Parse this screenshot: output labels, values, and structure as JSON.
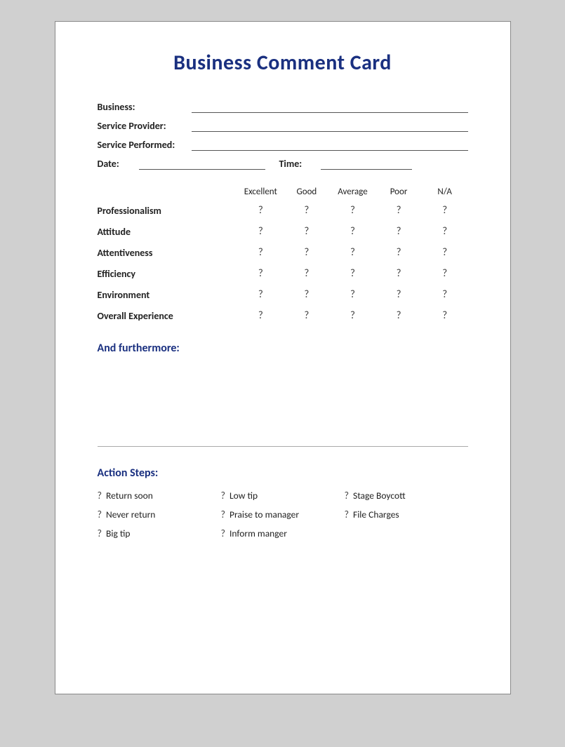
{
  "card": {
    "title": "Business Comment Card",
    "fields": {
      "business_label": "Business:",
      "service_provider_label": "Service Provider:",
      "service_performed_label": "Service Performed:",
      "date_label": "Date:",
      "time_label": "Time:"
    },
    "ratings": {
      "headers": [
        "Excellent",
        "Good",
        "Average",
        "Poor",
        "N/A"
      ],
      "rows": [
        {
          "label": "Professionalism"
        },
        {
          "label": "Attitude"
        },
        {
          "label": "Attentiveness"
        },
        {
          "label": "Efficiency"
        },
        {
          "label": "Environment"
        },
        {
          "label": "Overall Experience"
        }
      ],
      "symbol": "?"
    },
    "furthermore": {
      "title": "And furthermore:"
    },
    "action_steps": {
      "title": "Action Steps:",
      "items": [
        {
          "symbol": "?",
          "text": "Return soon"
        },
        {
          "symbol": "?",
          "text": "Never return"
        },
        {
          "symbol": "?",
          "text": "Big tip"
        },
        {
          "symbol": "?",
          "text": "Low tip"
        },
        {
          "symbol": "?",
          "text": "Praise to manager"
        },
        {
          "symbol": "?",
          "text": "Inform manger"
        },
        {
          "symbol": "?",
          "text": "Stage Boycott"
        },
        {
          "symbol": "?",
          "text": "File Charges"
        },
        {
          "symbol": "",
          "text": ""
        }
      ]
    }
  }
}
